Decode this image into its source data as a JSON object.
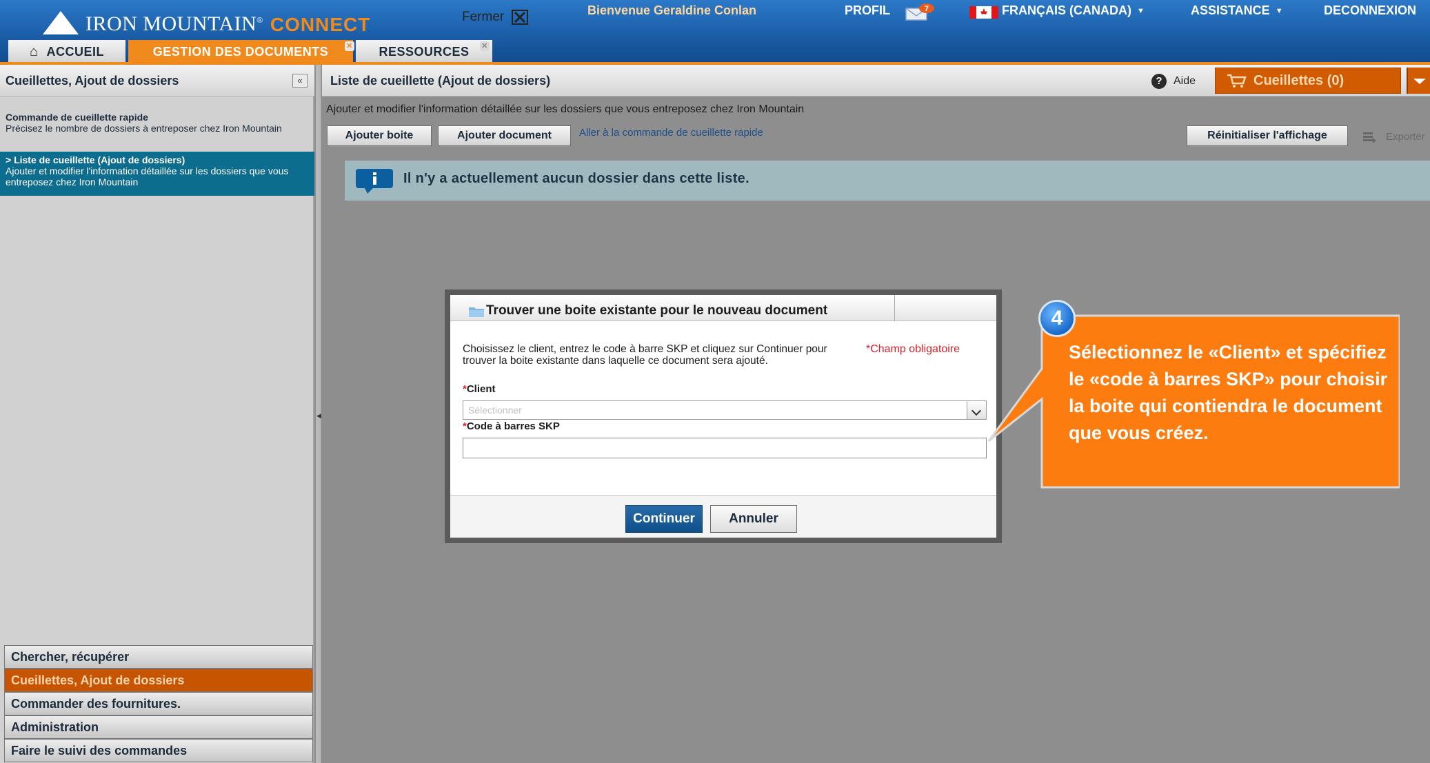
{
  "header": {
    "logo_brand": "IRON MOUNTAIN",
    "logo_trademark": "®",
    "logo_product": "CONNECT",
    "welcome": "Bienvenue Geraldine Conlan",
    "profile": "PROFIL",
    "mail_count": "7",
    "language": "FRANÇAIS (CANADA)",
    "help": "ASSISTANCE",
    "logout": "DECONNEXION",
    "caret": "▼"
  },
  "tabs": {
    "home": "ACCUEIL",
    "documents": "GESTION DES DOCUMENTS",
    "resources": "RESSOURCES",
    "close_glyph": "✕"
  },
  "sidebar": {
    "title": "Cueillettes, Ajout de dossiers",
    "collapse_glyph": "«",
    "quick_order": {
      "title": "Commande de cueillette rapide",
      "desc": "Précisez le nombre de dossiers à entreposer chez Iron Mountain"
    },
    "pickup_list": {
      "title": "> Liste de cueillette (Ajout de dossiers)",
      "desc": "Ajouter et modifier l'information détaillée sur les dossiers que vous entreposez chez Iron Mountain"
    },
    "accordion": [
      "Chercher, récupérer",
      "Cueillettes, Ajout de dossiers",
      "Commander des fournitures.",
      "Administration",
      "Faire le suivi des commandes"
    ]
  },
  "content": {
    "title": "Liste de cueillette (Ajout de dossiers)",
    "help_label": "Aide",
    "cart_label": "Cueillettes (0)",
    "intro": "Ajouter et modifier l'information détaillée sur les dossiers que vous entreposez chez Iron Mountain",
    "add_box": "Ajouter boite",
    "add_document": "Ajouter document",
    "quick_link": "Aller à la commande de cueillette rapide",
    "reset_view": "Réinitialiser l'affichage",
    "export": "Exporter",
    "empty_message": "Il n'y a actuellement aucun dossier dans cette liste."
  },
  "dialog": {
    "title": "Trouver une boite existante pour le nouveau document",
    "close_label": "Fermer",
    "description": "Choisissez le client, entrez le code à barre SKP et cliquez sur Continuer pour trouver la boite existante dans laquelle ce document sera ajouté.",
    "required_note": "*Champ obligatoire",
    "required_star": "*",
    "client_label": "Client",
    "client_placeholder": "Sélectionner",
    "barcode_label": "Code à barres SKP",
    "barcode_value": "",
    "continue": "Continuer",
    "cancel": "Annuler"
  },
  "callout": {
    "step": "4",
    "text": "Sélectionnez le «Client» et spécifiez le «code à barres SKP» pour choisir la boite qui contiendra le document que vous créez."
  },
  "colors": {
    "brand_blue": "#1b5ea8",
    "brand_orange": "#f08a1c",
    "callout_orange": "#fd7c10",
    "selected_nav": "#0d6d8f"
  }
}
